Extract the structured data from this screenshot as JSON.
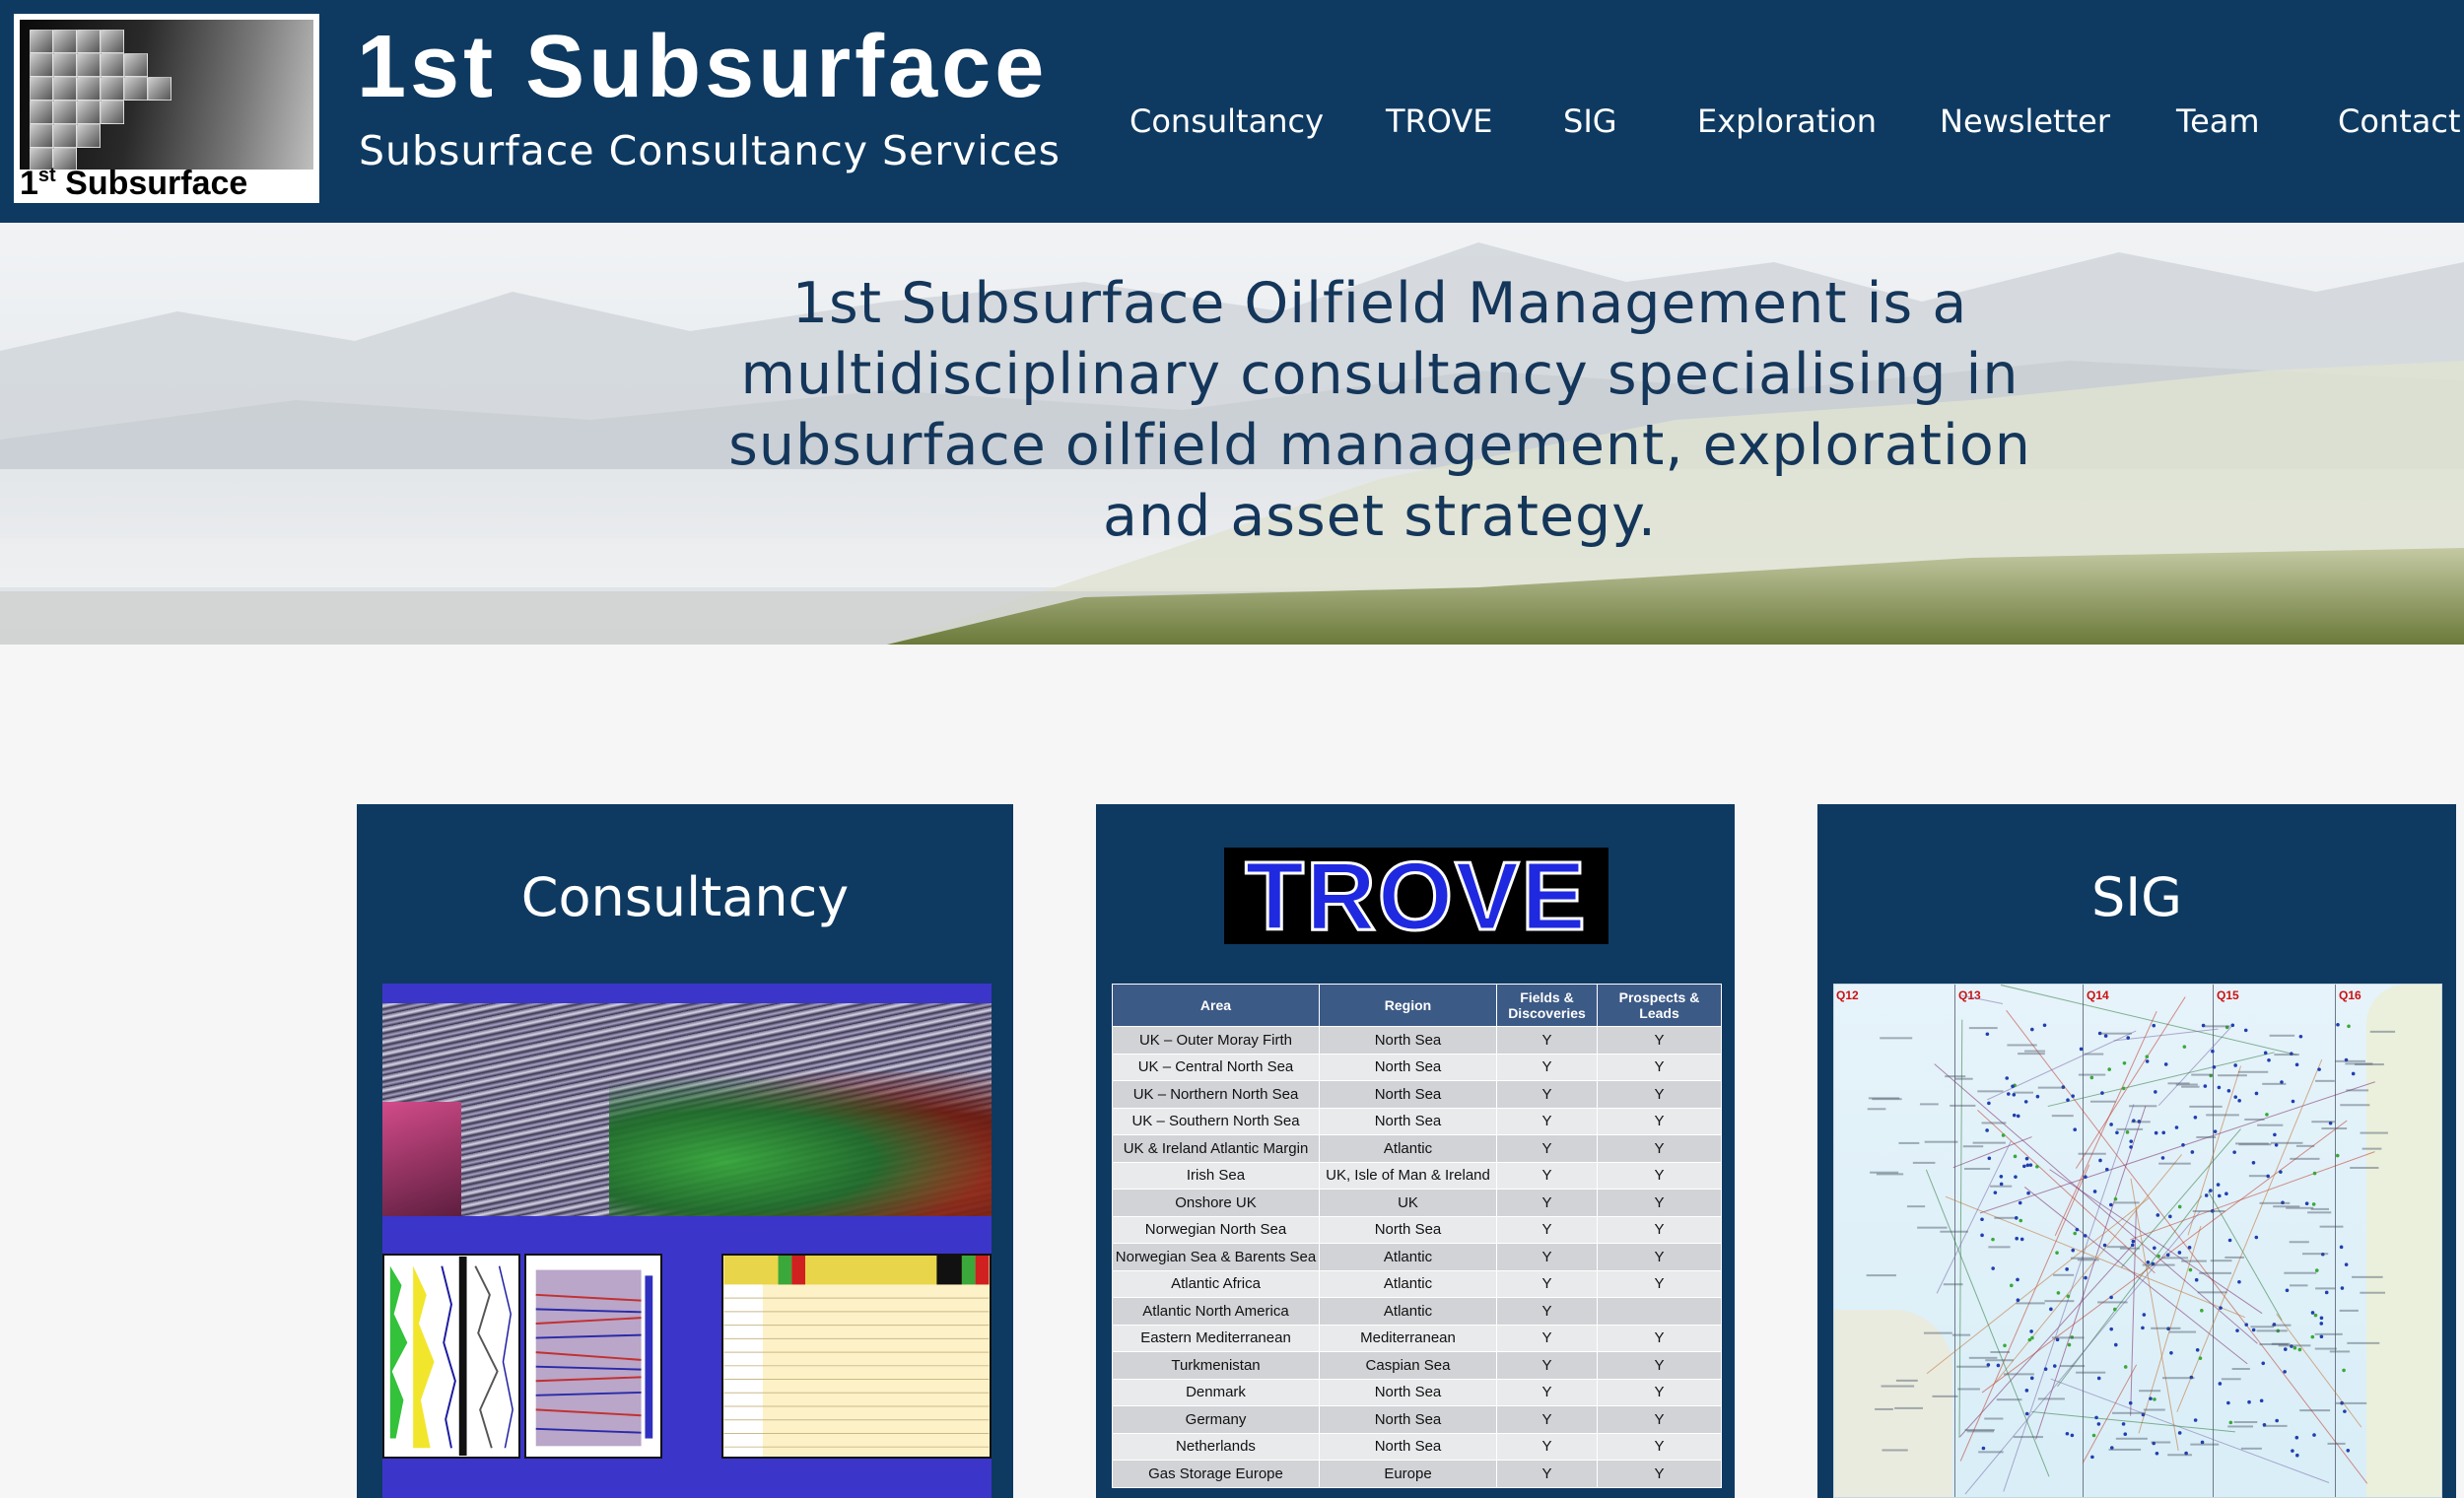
{
  "header": {
    "logo_text": "1",
    "logo_sup": "st",
    "logo_text_rest": " Subsurface",
    "brand_title": "1st Subsurface",
    "brand_tagline": "Subsurface Consultancy Services"
  },
  "nav": {
    "items": [
      {
        "label": "Consultancy"
      },
      {
        "label": "TROVE"
      },
      {
        "label": "SIG"
      },
      {
        "label": "Exploration"
      },
      {
        "label": "Newsletter"
      },
      {
        "label": "Team"
      },
      {
        "label": "Contact"
      }
    ]
  },
  "hero": {
    "line1": "1st Subsurface Oilfield Management is a",
    "line2": "multidisciplinary consultancy specialising in",
    "line3": "subsurface oilfield management, exploration",
    "line4": "and asset strategy."
  },
  "cards": {
    "consultancy": {
      "title": "Consultancy"
    },
    "trove": {
      "logo": "TROVE",
      "headers": [
        "Area",
        "Region",
        "Fields & Discoveries",
        "Prospects & Leads"
      ],
      "rows": [
        [
          "UK – Outer Moray Firth",
          "North Sea",
          "Y",
          "Y"
        ],
        [
          "UK – Central North Sea",
          "North Sea",
          "Y",
          "Y"
        ],
        [
          "UK – Northern North Sea",
          "North Sea",
          "Y",
          "Y"
        ],
        [
          "UK – Southern North Sea",
          "North Sea",
          "Y",
          "Y"
        ],
        [
          "UK & Ireland Atlantic Margin",
          "Atlantic",
          "Y",
          "Y"
        ],
        [
          "Irish Sea",
          "UK, Isle of Man & Ireland",
          "Y",
          "Y"
        ],
        [
          "Onshore UK",
          "UK",
          "Y",
          "Y"
        ],
        [
          "Norwegian North Sea",
          "North Sea",
          "Y",
          "Y"
        ],
        [
          "Norwegian Sea & Barents Sea",
          "Atlantic",
          "Y",
          "Y"
        ],
        [
          "Atlantic Africa",
          "Atlantic",
          "Y",
          "Y"
        ],
        [
          "Atlantic North America",
          "Atlantic",
          "Y",
          ""
        ],
        [
          "Eastern Mediterranean",
          "Mediterranean",
          "Y",
          "Y"
        ],
        [
          "Turkmenistan",
          "Caspian Sea",
          "Y",
          "Y"
        ],
        [
          "Denmark",
          "North Sea",
          "Y",
          "Y"
        ],
        [
          "Germany",
          "North Sea",
          "Y",
          "Y"
        ],
        [
          "Netherlands",
          "North Sea",
          "Y",
          "Y"
        ],
        [
          "Gas Storage Europe",
          "Europe",
          "Y",
          "Y"
        ]
      ]
    },
    "sig": {
      "title": "SIG",
      "quadrants": [
        "Q12",
        "Q13",
        "Q14",
        "Q15",
        "Q16"
      ]
    }
  },
  "colors": {
    "header_bg": "#0e3a61",
    "card_bg": "#0e3a61",
    "hero_text": "#14365a",
    "trove_blue": "#1f29e0"
  }
}
